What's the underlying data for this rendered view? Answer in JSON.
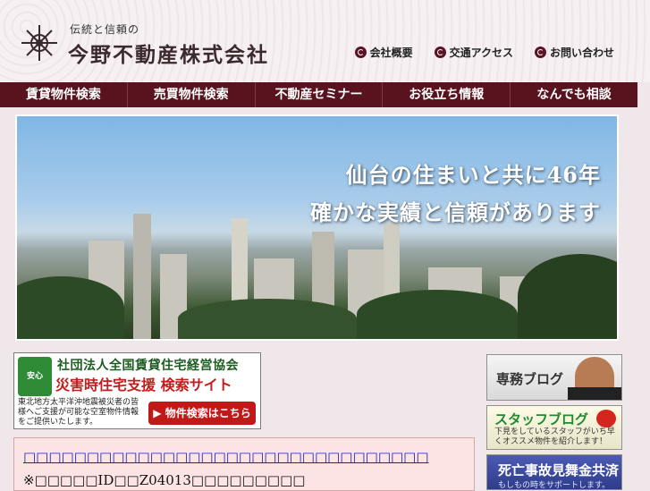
{
  "header": {
    "tagline": "伝統と信頼の",
    "company_name": "今野不動産株式会社",
    "links": [
      {
        "label": "会社概要"
      },
      {
        "label": "交通アクセス"
      },
      {
        "label": "お問い合わせ"
      }
    ]
  },
  "nav": {
    "items": [
      {
        "label": "賃貸物件検索"
      },
      {
        "label": "売買物件検索"
      },
      {
        "label": "不動産セミナー"
      },
      {
        "label": "お役立ち情報"
      },
      {
        "label": "なんでも相談"
      }
    ]
  },
  "hero": {
    "line1": "仙台の住まいと共に46年",
    "line2": "確かな実績と信頼があります"
  },
  "disaster_banner": {
    "badge": "安心",
    "org": "社団法人全国賃貸住宅経営協会",
    "title": "災害時住宅支援 検索サイト",
    "description": "東北地方太平洋沖地震被災者の皆様へご支援が可能な空室物件情報をご提供いたします。",
    "button_label": "▶ 物件検索はこちら"
  },
  "notice": {
    "link_text": "□□□□□□□□□□□□□□□□□□□□□□□□□□□□□□□□",
    "id_text": "※□□□□□ID□□Z04013□□□□□□□□□"
  },
  "sidebar": {
    "blog": {
      "title": "専務ブログ"
    },
    "staff_blog": {
      "title": "スタッフブログ",
      "description": "下見をしているスタッフがいち早くオススメ物件を紹介します！"
    },
    "mutual_aid": {
      "title": "死亡事故見舞金共済",
      "description": "もしもの時をサポートします。"
    }
  }
}
